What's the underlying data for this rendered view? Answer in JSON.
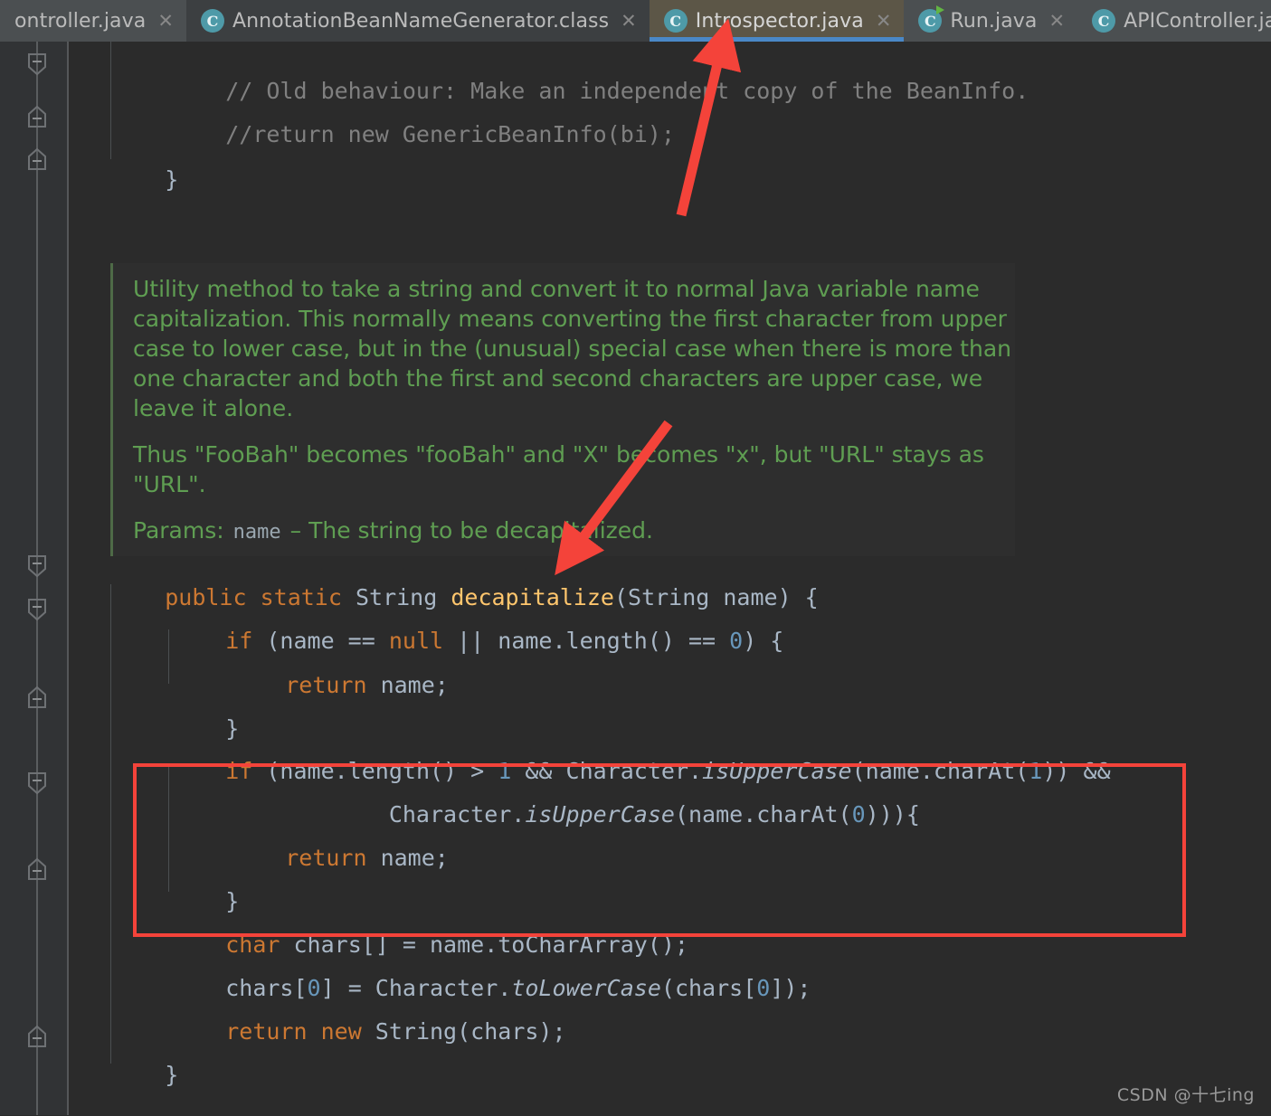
{
  "window": {
    "theme_background": "#2b2b2b",
    "gutter_background": "#313335",
    "accent_blue": "#4a88c7",
    "annotation_red": "#f4433a",
    "javadoc_green": "#5f9e52",
    "keyword_orange": "#cc7832",
    "method_yellow": "#ffc66d",
    "number_blue": "#6897bb",
    "text_grey": "#a9b7c6"
  },
  "tabs": [
    {
      "label": "ontroller.java",
      "icon": "java-class-icon",
      "close": "✕",
      "active": false,
      "style": "inactive-mid",
      "show_icon": false,
      "run": false
    },
    {
      "label": "AnnotationBeanNameGenerator.class",
      "icon": "java-class-icon",
      "close": "✕",
      "active": false,
      "style": "inactive-dark",
      "show_icon": true,
      "run": false
    },
    {
      "label": "Introspector.java",
      "icon": "java-class-icon",
      "close": "✕",
      "active": true,
      "style": "active",
      "show_icon": true,
      "run": false
    },
    {
      "label": "Run.java",
      "icon": "java-runnable-class-icon",
      "close": "✕",
      "active": false,
      "style": "inactive-mid",
      "show_icon": true,
      "run": true
    },
    {
      "label": "APIController.java",
      "icon": "java-class-icon",
      "close": "✕",
      "active": false,
      "style": "inactive-mid",
      "show_icon": true,
      "run": false
    }
  ],
  "code": {
    "comment_line_1": "// Old behaviour: Make an independent copy of the BeanInfo.",
    "comment_line_2": "//return new GenericBeanInfo(bi);",
    "close_brace_1": "}",
    "signature": {
      "kw_public": "public",
      "kw_static": "static",
      "type_string": "String",
      "method_name": "decapitalize",
      "params": "(String name) {"
    },
    "if_null": {
      "kw_if": "if",
      "rest_a": " (name == ",
      "kw_null": "null",
      "rest_b": " || name.length() == ",
      "num_zero": "0",
      "rest_c": ") {"
    },
    "return_name_1": {
      "kw": "return",
      "rest": " name;"
    },
    "close_brace_2": "}",
    "highlighted": {
      "line1": {
        "kw_if": "if",
        "part_a": " (name.length() > ",
        "num_one": "1",
        "part_b": " && Character.",
        "italic_method": "isUpperCase",
        "part_c": "(name.charAt(",
        "num_one2": "1",
        "part_d": ")) &&"
      },
      "line2": {
        "indent": "            Character.",
        "italic_method": "isUpperCase",
        "part_a": "(name.charAt(",
        "num_zero": "0",
        "part_b": "))){"
      },
      "line3": {
        "kw": "return",
        "rest": " name;"
      },
      "line4": "}"
    },
    "chars_decl": {
      "kw_char": "char",
      "rest": " chars[] = name.toCharArray();"
    },
    "chars_assign": {
      "part_a": "chars[",
      "num_zero_a": "0",
      "part_b": "] = Character.",
      "italic_method": "toLowerCase",
      "part_c": "(chars[",
      "num_zero_b": "0",
      "part_d": "]);"
    },
    "return_new": {
      "kw_return": "return",
      "kw_new": "new",
      "rest": " String(chars);"
    },
    "close_brace_3": "}"
  },
  "javadoc": {
    "paragraph_1": "Utility method to take a string and convert it to normal Java variable name capitalization. This normally means converting the first character from upper case to lower case, but in the (unusual) special case when there is more than one character and both the first and second characters are upper case, we leave it alone.",
    "paragraph_2": "Thus \"FooBah\" becomes \"fooBah\" and \"X\" becomes \"x\", but \"URL\" stays as \"URL\".",
    "params_label": "Params:",
    "param_name": "name",
    "param_desc": "– The string to be decapitalized."
  },
  "annotations": {
    "arrow_to_tab": "red-arrow-pointing-to-introspector-tab",
    "arrow_to_method": "red-arrow-pointing-to-decapitalize-method",
    "red_box": "red-highlight-box-around-isuppercase-check"
  },
  "watermark": "CSDN @十七ing"
}
